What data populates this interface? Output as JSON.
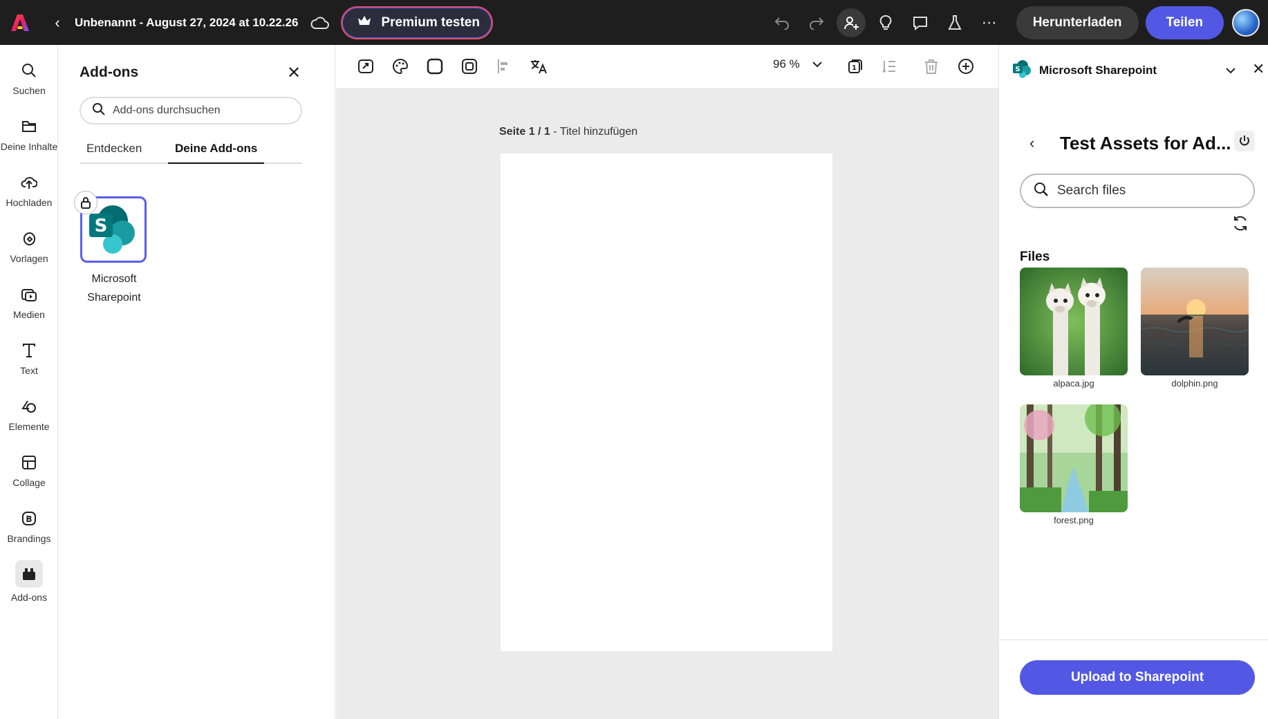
{
  "topbar": {
    "doc_title": "Unbenannt - August 27, 2024 at 10.22.26",
    "premium_label": "Premium testen",
    "download_label": "Herunterladen",
    "share_label": "Teilen",
    "accent_color": "#5258e4"
  },
  "rail": {
    "items": [
      {
        "label": "Suchen",
        "icon": "search-icon"
      },
      {
        "label": "Deine Inhalte",
        "icon": "folder-icon"
      },
      {
        "label": "Hochladen",
        "icon": "upload-cloud-icon"
      },
      {
        "label": "Vorlagen",
        "icon": "templates-icon"
      },
      {
        "label": "Medien",
        "icon": "media-icon"
      },
      {
        "label": "Text",
        "icon": "text-icon"
      },
      {
        "label": "Elemente",
        "icon": "elements-icon"
      },
      {
        "label": "Collage",
        "icon": "collage-icon"
      },
      {
        "label": "Brandings",
        "icon": "branding-icon"
      },
      {
        "label": "Add-ons",
        "icon": "addons-icon"
      }
    ]
  },
  "addons_panel": {
    "title": "Add-ons",
    "search_placeholder": "Add-ons durchsuchen",
    "tabs": [
      {
        "label": "Entdecken"
      },
      {
        "label": "Deine Add-ons"
      }
    ],
    "addon": {
      "name_line1": "Microsoft",
      "name_line2": "Sharepoint"
    }
  },
  "toolbar": {
    "zoom": "96 %"
  },
  "canvas": {
    "page_prefix": "Seite 1 / 1",
    "page_suffix": " - Titel hinzufügen"
  },
  "sharepoint_panel": {
    "title": "Microsoft Sharepoint",
    "folder_title": "Test Assets for Ad...",
    "search_placeholder": "Search files",
    "files_label": "Files",
    "files": [
      {
        "name": "alpaca.jpg"
      },
      {
        "name": "dolphin.png"
      },
      {
        "name": "forest.png"
      }
    ],
    "upload_label": "Upload to Sharepoint"
  }
}
